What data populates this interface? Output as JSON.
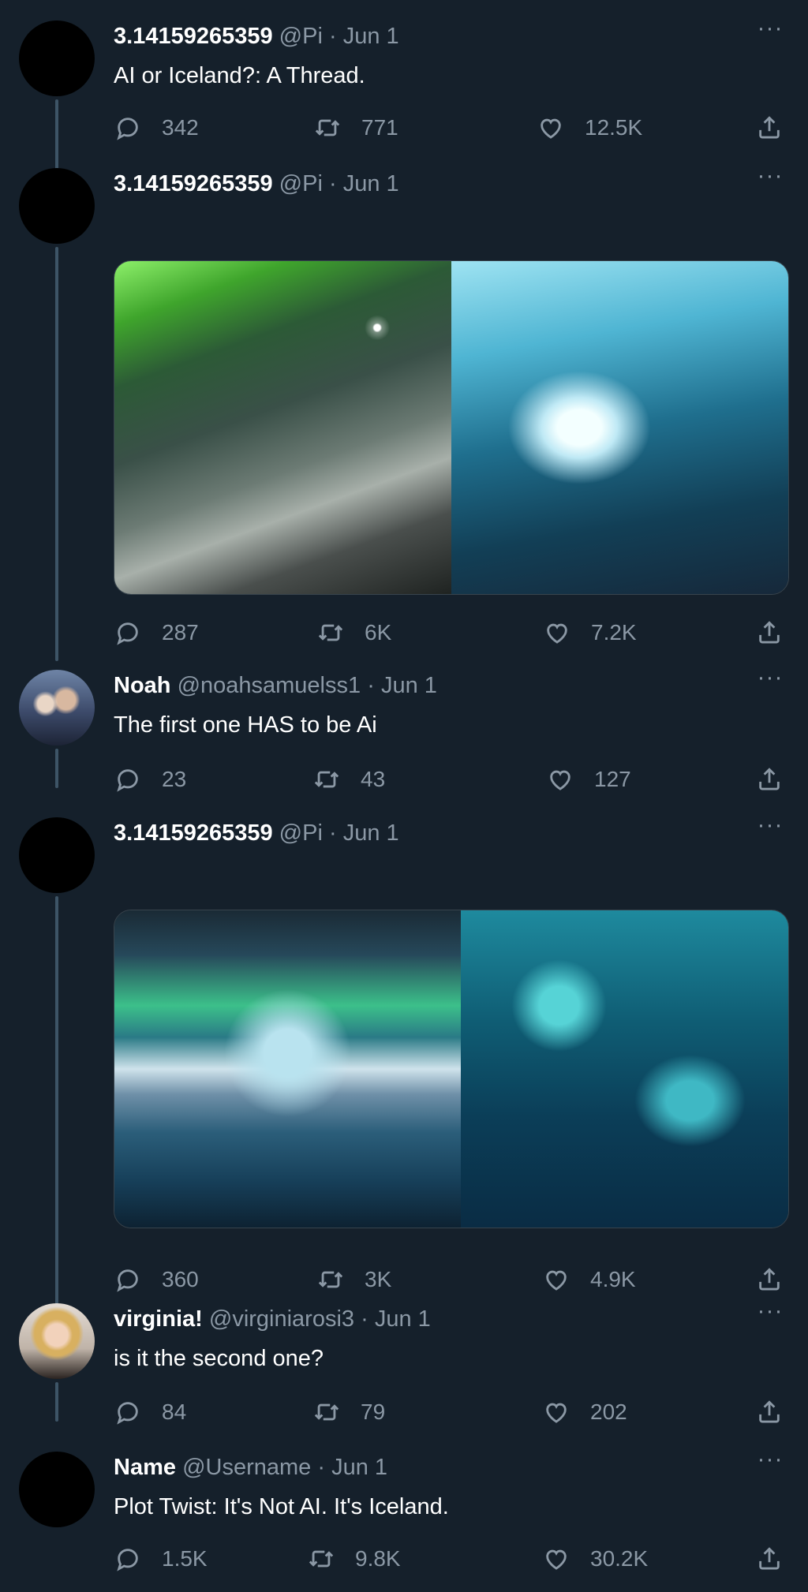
{
  "tweets": [
    {
      "name": "3.14159265359",
      "handle": "@Pi",
      "date": "Jun 1",
      "text": "AI or Iceland?: A Thread.",
      "replies": "342",
      "retweets": "771",
      "likes": "12.5K"
    },
    {
      "name": "3.14159265359",
      "handle": "@Pi",
      "date": "Jun 1",
      "replies": "287",
      "retweets": "6K",
      "likes": "7.2K"
    },
    {
      "name": "Noah",
      "handle": "@noahsamuelss1",
      "date": "Jun 1",
      "text": "The first one HAS to be Ai",
      "replies": "23",
      "retweets": "43",
      "likes": "127"
    },
    {
      "name": "3.14159265359",
      "handle": "@Pi",
      "date": "Jun 1",
      "replies": "360",
      "retweets": "3K",
      "likes": "4.9K"
    },
    {
      "name": "virginia!",
      "handle": "@virginiarosi3",
      "date": "Jun 1",
      "text": "is it the second one?",
      "replies": "84",
      "retweets": "79",
      "likes": "202"
    },
    {
      "name": "Name",
      "handle": "@Username",
      "date": "Jun 1",
      "text": "Plot Twist: It's Not AI. It's Iceland.",
      "replies": "1.5K",
      "retweets": "9.8K",
      "likes": "30.2K"
    }
  ],
  "dot": "·",
  "more_icon": "···",
  "colors": {
    "background": "#15202b",
    "secondary_text": "#8b98a5",
    "thread_line": "#3d5466"
  },
  "icons": [
    "reply-icon",
    "retweet-icon",
    "like-icon",
    "share-icon",
    "more-icon"
  ]
}
